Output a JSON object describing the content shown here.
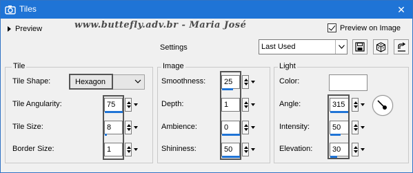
{
  "window": {
    "title": "Tiles"
  },
  "topbar": {
    "preview_label": "Preview",
    "watermark": "www.buttefly.adv.br - Maria José",
    "preview_on_image_label": "Preview on Image",
    "preview_on_image_checked": true
  },
  "settings": {
    "label": "Settings",
    "preset_value": "Last Used"
  },
  "tile": {
    "group_title": "Tile",
    "shape_label": "Tile Shape:",
    "shape_value": "Hexagon",
    "angularity_label": "Tile Angularity:",
    "angularity_value": "75",
    "size_label": "Tile Size:",
    "size_value": "8",
    "border_label": "Border Size:",
    "border_value": "1"
  },
  "image": {
    "group_title": "Image",
    "smoothness_label": "Smoothness:",
    "smoothness_value": "25",
    "depth_label": "Depth:",
    "depth_value": "1",
    "ambience_label": "Ambience:",
    "ambience_value": "0",
    "shininess_label": "Shininess:",
    "shininess_value": "50"
  },
  "light": {
    "group_title": "Light",
    "color_label": "Color:",
    "color_value": "#ffffff",
    "angle_label": "Angle:",
    "angle_value": "315",
    "intensity_label": "Intensity:",
    "intensity_value": "50",
    "elevation_label": "Elevation:",
    "elevation_value": "30"
  },
  "colors": {
    "accent": "#1f74d6",
    "highlight_border": "#555555"
  }
}
